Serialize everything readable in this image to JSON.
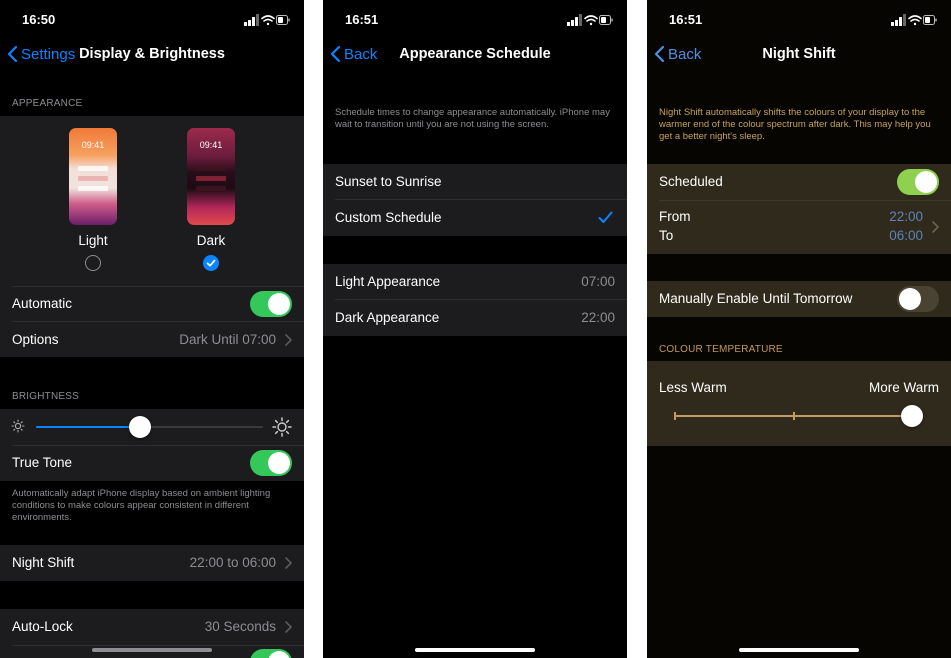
{
  "icons": {
    "status": [
      "signal-icon",
      "wifi-icon",
      "battery-icon"
    ],
    "chevron": "chevron-right-icon",
    "check": "checkmark-icon",
    "sun_small": "sun-small-icon",
    "sun_large": "sun-large-icon"
  },
  "colors": {
    "accent": "#0a84ff",
    "toggle_on": "#34c759",
    "night_toggle_on": "#8fd14f",
    "night_tint": "#2f2a1c"
  },
  "display": {
    "status_time": "16:50",
    "back_label": "Settings",
    "title": "Display & Brightness",
    "appearance_header": "APPEARANCE",
    "light": {
      "label": "Light",
      "preview_time": "09:41",
      "selected": false
    },
    "dark": {
      "label": "Dark",
      "preview_time": "09:41",
      "selected": true
    },
    "automatic_label": "Automatic",
    "automatic_on": true,
    "options_label": "Options",
    "options_value": "Dark Until 07:00",
    "brightness_header": "BRIGHTNESS",
    "brightness_level": 0.46,
    "true_tone_label": "True Tone",
    "true_tone_on": true,
    "true_tone_footer": "Automatically adapt iPhone display based on ambient lighting conditions to make colours appear consistent in different environments.",
    "night_shift_label": "Night Shift",
    "night_shift_value": "22:00 to 06:00",
    "auto_lock_label": "Auto-Lock",
    "auto_lock_value": "30 Seconds"
  },
  "schedule": {
    "status_time": "16:51",
    "back_label": "Back",
    "title": "Appearance Schedule",
    "description": "Schedule times to change appearance automatically. iPhone may wait to transition until you are not using the screen.",
    "options": [
      {
        "label": "Sunset to Sunrise",
        "selected": false
      },
      {
        "label": "Custom Schedule",
        "selected": true
      }
    ],
    "light_label": "Light Appearance",
    "light_value": "07:00",
    "dark_label": "Dark Appearance",
    "dark_value": "22:00"
  },
  "night_shift": {
    "status_time": "16:51",
    "back_label": "Back",
    "title": "Night Shift",
    "description": "Night Shift automatically shifts the colours of your display to the warmer end of the colour spectrum after dark. This may help you get a better night's sleep.",
    "scheduled_label": "Scheduled",
    "scheduled_on": true,
    "from_label": "From",
    "from_value": "22:00",
    "to_label": "To",
    "to_value": "06:00",
    "manual_label": "Manually Enable Until Tomorrow",
    "manual_on": false,
    "temp_header": "COLOUR TEMPERATURE",
    "less_warm_label": "Less Warm",
    "more_warm_label": "More Warm",
    "temperature_level": 1.0
  }
}
